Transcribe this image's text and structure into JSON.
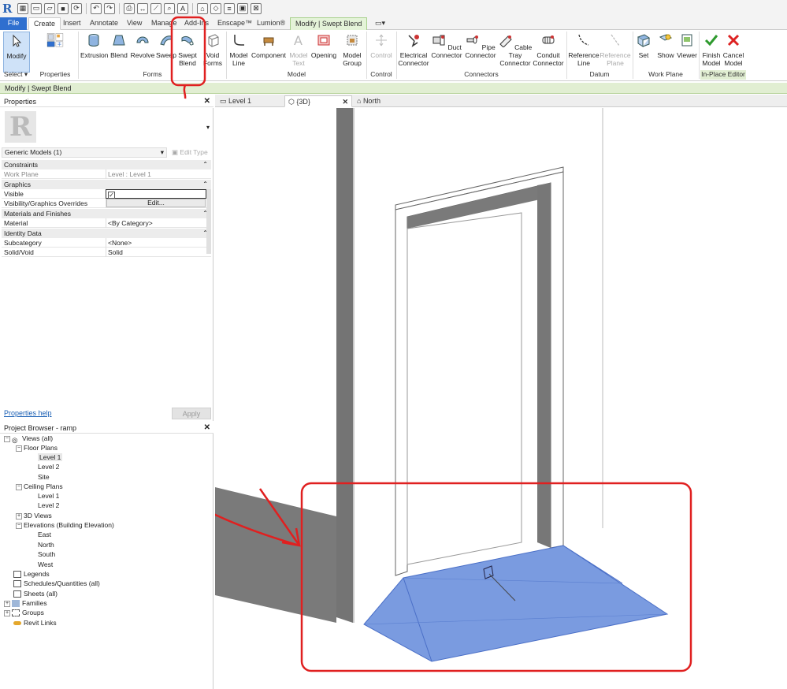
{
  "tabs": [
    "File",
    "Create",
    "Insert",
    "Annotate",
    "View",
    "Manage",
    "Add-Ins",
    "Enscape™",
    "Lumion®",
    "Modify | Swept Blend"
  ],
  "ribbon": {
    "select": {
      "modify": "Modify",
      "select_label": "Select ▾",
      "properties_label": "Properties"
    },
    "forms": {
      "extrusion": "Extrusion",
      "blend": "Blend",
      "revolve": "Revolve",
      "sweep": "Sweep",
      "swept_blend_1": "Swept",
      "swept_blend_2": "Blend",
      "void_1": "Void",
      "void_2": "Forms",
      "panel": "Forms"
    },
    "model": {
      "model_line_1": "Model",
      "model_line_2": "Line",
      "component": "Component",
      "model_text_1": "Model",
      "model_text_2": "Text",
      "opening": "Opening",
      "model_group_1": "Model",
      "model_group_2": "Group",
      "panel": "Model"
    },
    "control": {
      "label": "Control",
      "panel": "Control"
    },
    "connectors": {
      "electrical_1": "Electrical",
      "electrical_2": "Connector",
      "duct_1": "Duct",
      "duct_2": "Connector",
      "pipe_1": "Pipe",
      "pipe_2": "Connector",
      "cable_1": "Cable Tray",
      "cable_2": "Connector",
      "conduit_1": "Conduit",
      "conduit_2": "Connector",
      "panel": "Connectors"
    },
    "datum": {
      "ref_line_1": "Reference",
      "ref_line_2": "Line",
      "ref_plane_1": "Reference",
      "ref_plane_2": "Plane",
      "panel": "Datum"
    },
    "work_plane": {
      "set": "Set",
      "show": "Show",
      "viewer": "Viewer",
      "panel": "Work Plane"
    },
    "inplace": {
      "finish_1": "Finish",
      "finish_2": "Model",
      "cancel_1": "Cancel",
      "cancel_2": "Model",
      "panel": "In-Place Editor"
    }
  },
  "context_bar": "Modify | Swept Blend",
  "properties": {
    "title": "Properties",
    "type": "Generic Models (1)",
    "edit_type": "Edit Type",
    "groups": {
      "constraints": "Constraints",
      "graphics": "Graphics",
      "materials": "Materials and Finishes",
      "identity": "Identity Data"
    },
    "rows": {
      "work_plane": {
        "k": "Work Plane",
        "v": "Level : Level 1"
      },
      "visible": {
        "k": "Visible",
        "v": "✓"
      },
      "vg": {
        "k": "Visibility/Graphics Overrides",
        "v": "Edit..."
      },
      "material": {
        "k": "Material",
        "v": "<By Category>"
      },
      "subcategory": {
        "k": "Subcategory",
        "v": "<None>"
      },
      "solid_void": {
        "k": "Solid/Void",
        "v": "Solid"
      }
    },
    "help": "Properties help",
    "apply": "Apply"
  },
  "browser": {
    "title": "Project Browser - ramp",
    "views_all": "Views (all)",
    "floor_plans": "Floor Plans",
    "fp_level1": "Level 1",
    "fp_level2": "Level 2",
    "fp_site": "Site",
    "ceiling_plans": "Ceiling Plans",
    "cp_level1": "Level 1",
    "cp_level2": "Level 2",
    "views_3d": "3D Views",
    "elevations": "Elevations (Building Elevation)",
    "east": "East",
    "north": "North",
    "south": "South",
    "west": "West",
    "legends": "Legends",
    "schedules": "Schedules/Quantities (all)",
    "sheets": "Sheets (all)",
    "families": "Families",
    "groups": "Groups",
    "revit_links": "Revit Links"
  },
  "view_tabs": {
    "level1": "Level 1",
    "view3d": "{3D}",
    "north": "North"
  },
  "colors": {
    "accent": "#2f6fcf",
    "annotation": "#e02020",
    "selection": "#7a9be0",
    "context": "#e1eed2"
  }
}
